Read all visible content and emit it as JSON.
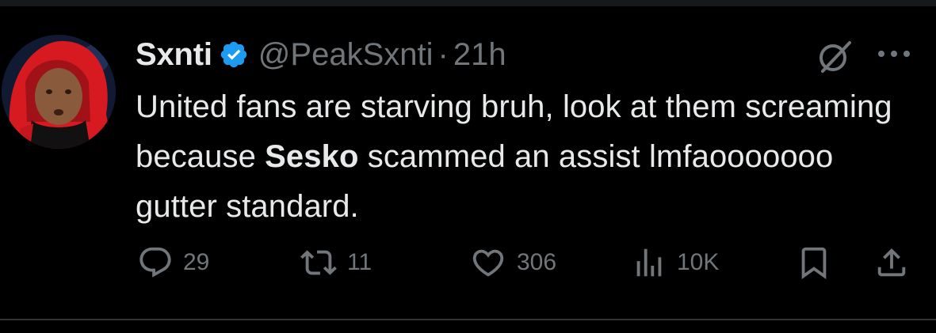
{
  "user": {
    "display_name": "Sxnti",
    "handle": "@PeakSxnti",
    "separator": "·",
    "time": "21h"
  },
  "tweet": {
    "text_before": "United fans are starving bruh, look at them screaming because ",
    "text_bold": "Sesko",
    "text_after": " scammed an assist lmfaooooooo gutter standard."
  },
  "actions": {
    "replies": "29",
    "reposts": "11",
    "likes": "306",
    "views": "10K"
  },
  "colors": {
    "background": "#000000",
    "text_primary": "#e7e9ea",
    "text_secondary": "#71767b",
    "verified_badge": "#1d9bf0"
  },
  "icons": [
    "verified-badge-icon",
    "grok-icon",
    "more-icon",
    "reply-icon",
    "repost-icon",
    "like-icon",
    "views-icon",
    "bookmark-icon",
    "share-icon"
  ]
}
